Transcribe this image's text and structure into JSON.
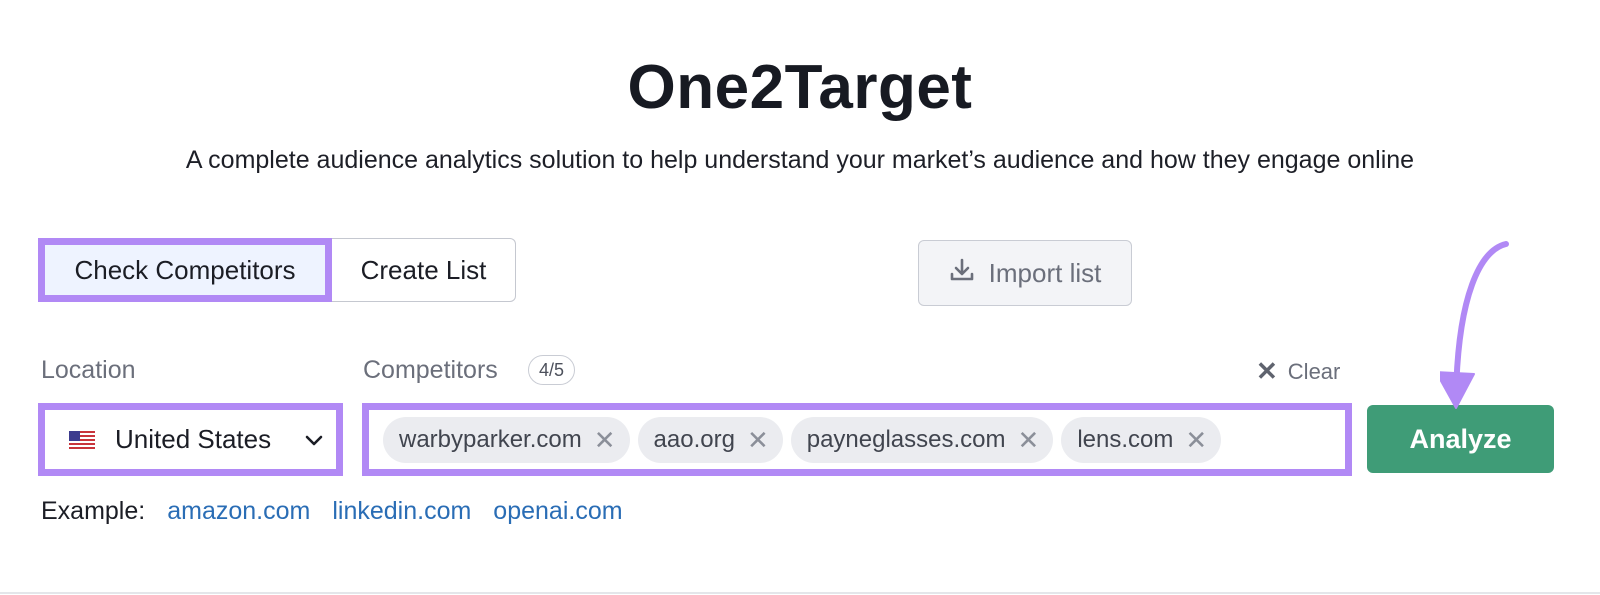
{
  "header": {
    "title": "One2Target",
    "subtitle": "A complete audience analytics solution to help understand your market’s audience and how they engage online"
  },
  "mode_tabs": {
    "check_competitors": "Check Competitors",
    "create_list": "Create List",
    "selected": "Check Competitors"
  },
  "import_button": {
    "label": "Import list",
    "icon": "download-icon"
  },
  "location": {
    "label": "Location",
    "value": "United States",
    "flag_icon": "us-flag-icon"
  },
  "competitors": {
    "label": "Competitors",
    "count": "4/5",
    "clear_label": "Clear",
    "chips": [
      {
        "label": "warbyparker.com"
      },
      {
        "label": "aao.org"
      },
      {
        "label": "payneglasses.com"
      },
      {
        "label": "lens.com"
      }
    ]
  },
  "analyze_button": {
    "label": "Analyze"
  },
  "examples": {
    "label": "Example:",
    "links": [
      "amazon.com",
      "linkedin.com",
      "openai.com"
    ]
  },
  "colors": {
    "highlight_border": "#b189f5",
    "analyze_green": "#3f9c77",
    "link_blue": "#2a6db5"
  }
}
